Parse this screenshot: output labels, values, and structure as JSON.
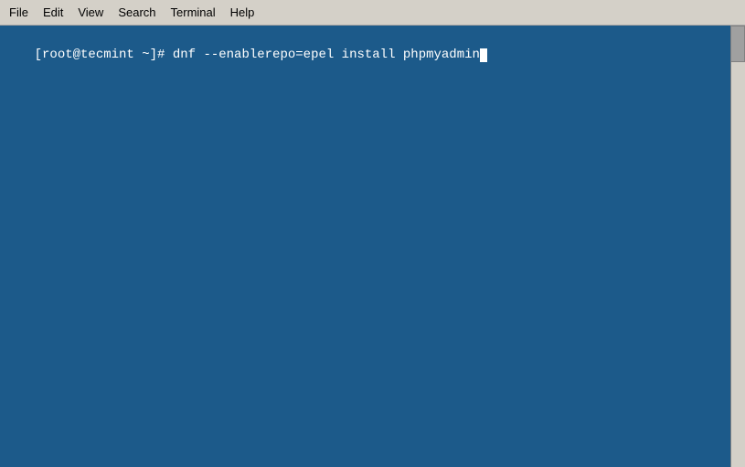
{
  "menubar": {
    "items": [
      {
        "label": "File",
        "id": "file"
      },
      {
        "label": "Edit",
        "id": "edit"
      },
      {
        "label": "View",
        "id": "view"
      },
      {
        "label": "Search",
        "id": "search"
      },
      {
        "label": "Terminal",
        "id": "terminal"
      },
      {
        "label": "Help",
        "id": "help"
      }
    ]
  },
  "terminal": {
    "prompt": "[root@tecmint ~]# ",
    "command": "dnf --enablerepo=epel install phpmyadmin"
  },
  "colors": {
    "background": "#1c5a8a",
    "menubar_bg": "#d4d0c8",
    "text": "#ffffff"
  }
}
